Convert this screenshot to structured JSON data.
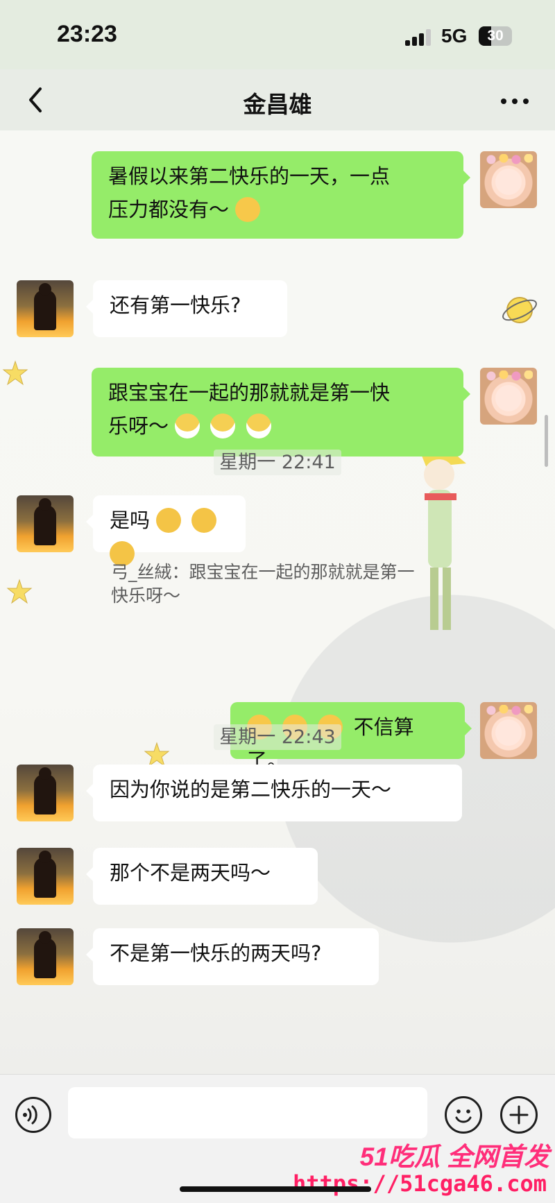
{
  "status_bar": {
    "time": "23:23",
    "network": "5G",
    "battery": "30"
  },
  "header": {
    "title": "金昌雄"
  },
  "chat": {
    "messages": [
      {
        "text": "暑假以来第二快乐的一天，一点\n压力都没有～",
        "sender": "me",
        "emoji": "laugh-icon"
      },
      {
        "text": "还有第一快乐?",
        "sender": "peer"
      },
      {
        "text": "跟宝宝在一起的那就就是第一快\n乐呀～",
        "sender": "me",
        "emoji": "grin-icon"
      },
      {
        "text": "是吗",
        "sender": "peer",
        "emoji": "cover-face-icon"
      },
      {
        "text": "不信算了。",
        "sender": "me",
        "emoji": "hmph-icon"
      },
      {
        "text": "因为你说的是第二快乐的一天～",
        "sender": "peer"
      },
      {
        "text": "那个不是两天吗～",
        "sender": "peer"
      },
      {
        "text": "不是第一快乐的两天吗?",
        "sender": "peer"
      }
    ],
    "timestamps": [
      "星期一 22:41",
      "星期一 22:43"
    ],
    "quote": {
      "text": "弓_丝絨：跟宝宝在一起的那就就是第一\n快乐呀～"
    }
  },
  "watermark": {
    "line1": "51吃瓜 全网首发",
    "line2": "https://51cga46.com"
  },
  "colors": {
    "my_bubble": "#95ec69",
    "peer_bubble": "#ffffff"
  }
}
